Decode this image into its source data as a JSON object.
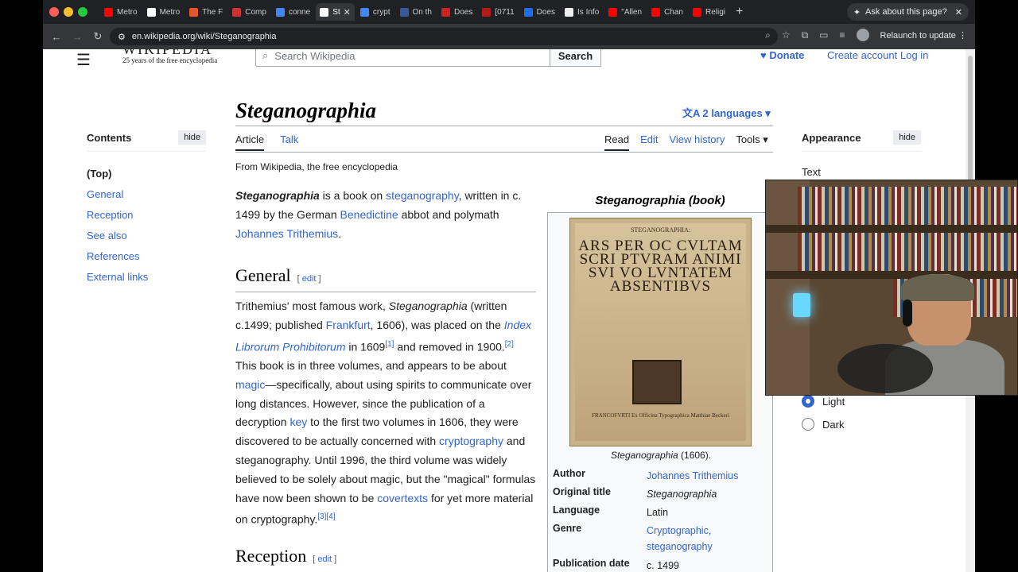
{
  "browser": {
    "tabs": [
      {
        "label": "Metro",
        "color": "#ff0000"
      },
      {
        "label": "Metro",
        "color": "#ffffff"
      },
      {
        "label": "The F",
        "color": "#e8552b"
      },
      {
        "label": "Comp",
        "color": "#c33"
      },
      {
        "label": "conne",
        "color": "#4285f4"
      },
      {
        "label": "St",
        "color": "#ffffff",
        "active": true
      },
      {
        "label": "crypt",
        "color": "#4285f4"
      },
      {
        "label": "On th",
        "color": "#3b5998"
      },
      {
        "label": "Does",
        "color": "#cc2222"
      },
      {
        "label": "[0711",
        "color": "#b31b1b"
      },
      {
        "label": "Does",
        "color": "#1f6feb"
      },
      {
        "label": "Is Info",
        "color": "#eeeeee"
      },
      {
        "label": "\"Allen",
        "color": "#ff0000"
      },
      {
        "label": "Chan",
        "color": "#ff0000"
      },
      {
        "label": "Religi",
        "color": "#ff0000"
      }
    ],
    "ask_label": "Ask about this page?",
    "url": "en.wikipedia.org/wiki/Steganographia",
    "relaunch_label": "Relaunch to update"
  },
  "header": {
    "logo_wordmark": "WIKIPEDIA",
    "logo_tagline": "25 years of the free encyclopedia",
    "search_placeholder": "Search Wikipedia",
    "search_button": "Search",
    "donate": "Donate",
    "create_account": "Create account",
    "log_in": "Log in"
  },
  "toc": {
    "title": "Contents",
    "hide": "hide",
    "items": [
      "(Top)",
      "General",
      "Reception",
      "See also",
      "References",
      "External links"
    ]
  },
  "article": {
    "title": "Steganographia",
    "languages": "2 languages",
    "tab_article": "Article",
    "tab_talk": "Talk",
    "tab_read": "Read",
    "tab_edit": "Edit",
    "tab_history": "View history",
    "tab_tools": "Tools",
    "from": "From Wikipedia, the free encyclopedia",
    "h_general": "General",
    "h_reception": "Reception",
    "edit": "edit"
  },
  "infobox": {
    "caption": "Steganographia (book)",
    "image_title_small": "STEGANOGRAPHIA:",
    "image_title_big": "ARS PER OC CVLTAM SCRI PTVRAM ANIMI SVI VO LVNTATEM ABSENTIBVS",
    "image_footer": "FRANCOFVRTI Ex Officina Typographica Matthiae Beckeri",
    "figure_caption_title": "Steganographia",
    "figure_caption_rest": " (1606).",
    "rows": [
      {
        "label": "Author",
        "value": "Johannes Trithemius",
        "link": true
      },
      {
        "label": "Original title",
        "value": "Steganographia",
        "italic": true
      },
      {
        "label": "Language",
        "value": "Latin"
      },
      {
        "label": "Genre",
        "value": "Cryptographic, steganography",
        "link": true
      },
      {
        "label": "Publication date",
        "value": "c. 1499"
      }
    ]
  },
  "appearance": {
    "title": "Appearance",
    "hide": "hide",
    "text_label": "Text",
    "light": "Light",
    "dark": "Dark",
    "selected": "Light"
  },
  "colors": {
    "link": "#3366cc",
    "text": "#202122"
  }
}
